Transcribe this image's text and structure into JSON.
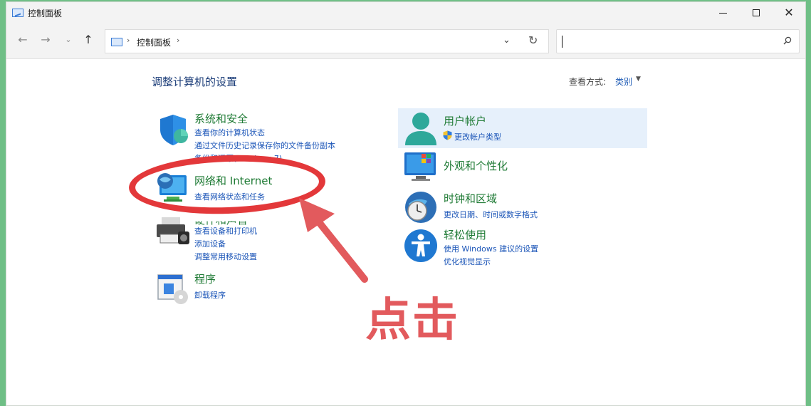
{
  "window": {
    "title": "控制面板"
  },
  "address": {
    "path": "控制面板",
    "search_placeholder": ""
  },
  "content": {
    "heading": "调整计算机的设置",
    "view_by_label": "查看方式:",
    "view_by_value": "类别"
  },
  "categories_left": [
    {
      "title": "系统和安全",
      "links": [
        "查看你的计算机状态",
        "通过文件历史记录保存你的文件备份副本",
        "备份和还原(Windows 7)"
      ]
    },
    {
      "title": "网络和 Internet",
      "links": [
        "查看网络状态和任务"
      ]
    },
    {
      "title": "硬件和声音",
      "links": [
        "查看设备和打印机",
        "添加设备",
        "调整常用移动设置"
      ]
    },
    {
      "title": "程序",
      "links": [
        "卸载程序"
      ]
    }
  ],
  "categories_right": [
    {
      "title": "用户帐户",
      "links": [
        "更改帐户类型"
      ]
    },
    {
      "title": "外观和个性化",
      "links": []
    },
    {
      "title": "时钟和区域",
      "links": [
        "更改日期、时间或数字格式"
      ]
    },
    {
      "title": "轻松使用",
      "links": [
        "使用 Windows 建议的设置",
        "优化视觉显示"
      ]
    }
  ],
  "annotation": {
    "text": "点击",
    "color": "#e3383a"
  }
}
